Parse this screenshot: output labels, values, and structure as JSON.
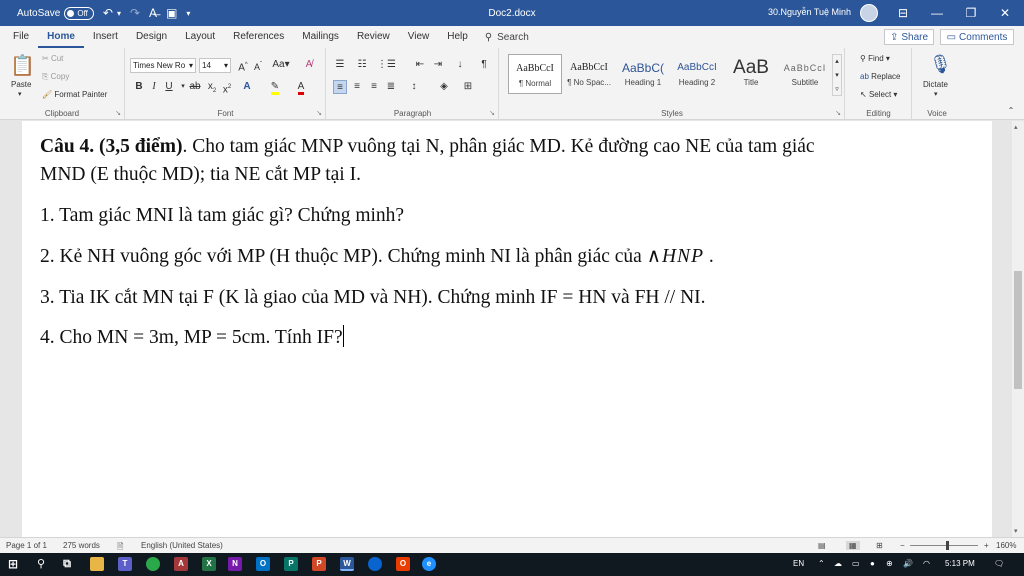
{
  "titlebar": {
    "autosave_label": "AutoSave",
    "autosave_state": "Off",
    "doc_title": "Doc2.docx",
    "user_name": "30.Nguyễn Tuệ Minh",
    "bg_color": "#2b579a"
  },
  "tabs": [
    {
      "label": "File"
    },
    {
      "label": "Home",
      "active": true
    },
    {
      "label": "Insert"
    },
    {
      "label": "Design"
    },
    {
      "label": "Layout"
    },
    {
      "label": "References"
    },
    {
      "label": "Mailings"
    },
    {
      "label": "Review"
    },
    {
      "label": "View"
    },
    {
      "label": "Help"
    }
  ],
  "search_label": "Search",
  "share_label": "Share",
  "comments_label": "Comments",
  "ribbon": {
    "clipboard": {
      "label": "Clipboard",
      "paste": "Paste",
      "cut": "Cut",
      "copy": "Copy",
      "format_painter": "Format Painter"
    },
    "font": {
      "label": "Font",
      "font_name": "Times New Ro",
      "font_size": "14"
    },
    "paragraph": {
      "label": "Paragraph"
    },
    "styles": {
      "label": "Styles",
      "items": [
        {
          "sample": "AaBbCcI",
          "name": "¶ Normal"
        },
        {
          "sample": "AaBbCcI",
          "name": "¶ No Spac..."
        },
        {
          "sample": "AaBbC(",
          "name": "Heading 1"
        },
        {
          "sample": "AaBbCcI",
          "name": "Heading 2"
        },
        {
          "sample": "AaB",
          "name": "Title"
        },
        {
          "sample": "AaBbCcI",
          "name": "Subtitle"
        }
      ]
    },
    "editing": {
      "label": "Editing",
      "find": "Find",
      "replace": "Replace",
      "select": "Select"
    },
    "voice": {
      "label": "Voice",
      "dictate": "Dictate"
    }
  },
  "document": {
    "q_title": "Câu 4. (3,5 điểm)",
    "q_intro_rest": ". Cho tam giác MNP vuông tại N, phân giác MD. Kẻ đường cao NE của tam giác",
    "q_intro_line2": "MND (E thuộc MD); tia NE cắt MP tại I.",
    "p1": "1. Tam giác MNI là tam giác gì? Chứng minh?",
    "p2_text": "2. Kẻ NH vuông góc với MP (H thuộc MP). Chứng minh NI là phân giác của ",
    "p2_math": "∧HNP",
    "p2_end": " .",
    "p3": "3. Tia IK cắt MN tại F (K là giao của MD và NH). Chứng minh IF = HN và FH // NI.",
    "p4": "4. Cho MN = 3m, MP = 5cm. Tính IF?"
  },
  "statusbar": {
    "page": "Page 1 of 1",
    "words": "275 words",
    "language": "English (United States)",
    "zoom": "160%"
  },
  "taskbar": {
    "lang": "EN",
    "time": "5:13 PM"
  }
}
